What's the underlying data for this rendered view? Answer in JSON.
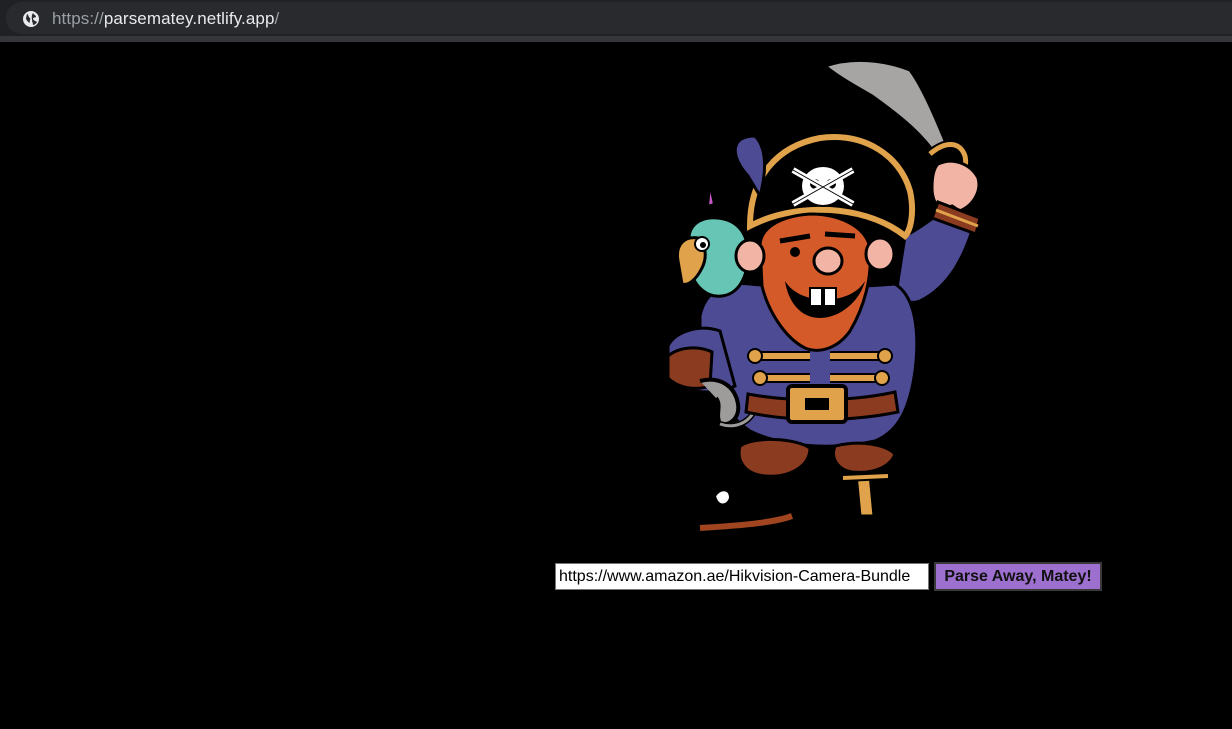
{
  "browser": {
    "url_scheme": "https://",
    "url_host": "parsematey.netlify.app",
    "url_rest": "/",
    "site_icon": "globe-icon"
  },
  "page": {
    "image_alt": "pirate-mascot-illustration",
    "input": {
      "value": "https://www.amazon.ae/Hikvision-Camera-Bundle",
      "placeholder": ""
    },
    "button_label": "Parse Away, Matey!"
  },
  "colors": {
    "background": "#000000",
    "button_bg": "#9d6fcf",
    "browser_bar": "#202124"
  }
}
